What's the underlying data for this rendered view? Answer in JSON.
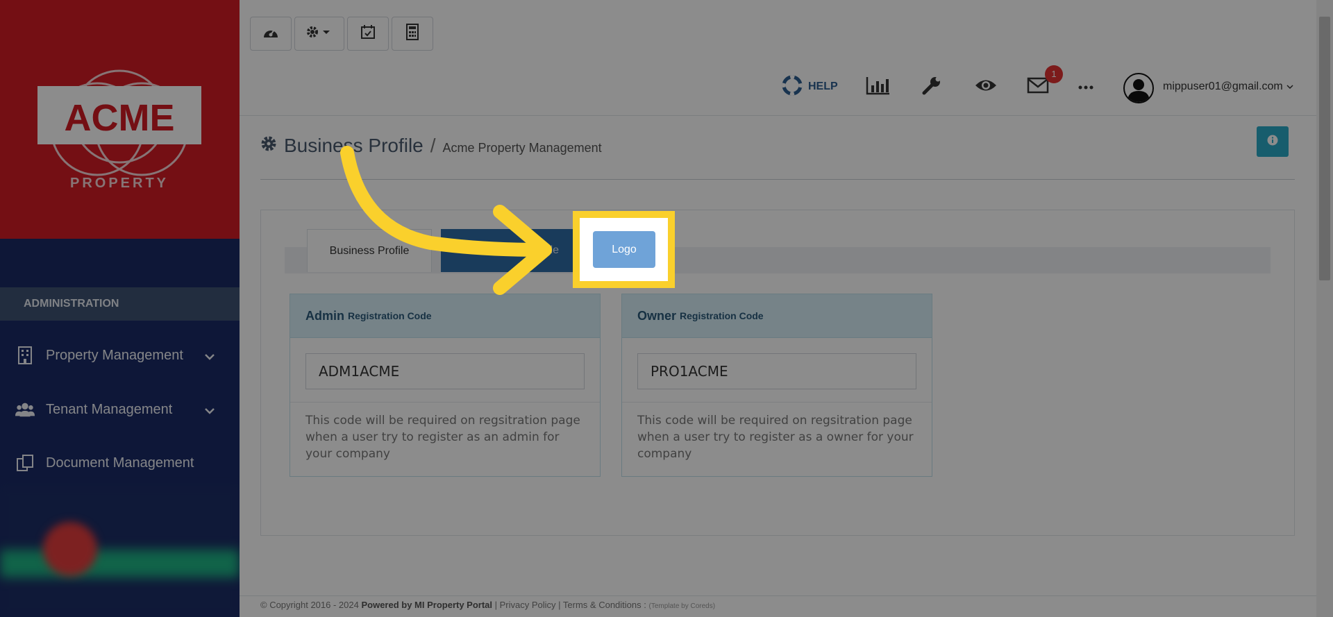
{
  "sidebar": {
    "logo": {
      "brand": "ACME",
      "sub": "PROPERTY"
    },
    "section_header": "ADMINISTRATION",
    "items": [
      {
        "label": "Property Management",
        "icon": "building-icon",
        "has_chevron": true
      },
      {
        "label": "Tenant Management",
        "icon": "users-icon",
        "has_chevron": true
      },
      {
        "label": "Document Management",
        "icon": "documents-icon",
        "has_chevron": false
      }
    ]
  },
  "toolbar": {
    "buttons": [
      {
        "icon": "dashboard-icon"
      },
      {
        "icon": "gear-dropdown-icon"
      },
      {
        "icon": "calendar-check-icon"
      },
      {
        "icon": "calculator-icon"
      }
    ]
  },
  "topnav": {
    "help_label": "HELP",
    "mail_badge": "1",
    "user_email": "mippuser01@gmail.com"
  },
  "page": {
    "title": "Business Profile",
    "separator": "/",
    "subtitle": "Acme Property Management"
  },
  "tabs": {
    "profile": "Business Profile",
    "code": "ode",
    "logo": "Logo"
  },
  "cards": {
    "admin": {
      "head_strong": "Admin",
      "head_small": "Registration Code",
      "code": "ADM1ACME",
      "note": "This code will be required on regsitration page when a user try to register as an admin for your company"
    },
    "owner": {
      "head_strong": "Owner",
      "head_small": "Registration Code",
      "code": "PRO1ACME",
      "note": "This code will be required on regsitration page when a user try to register as a owner for your company"
    }
  },
  "footer": {
    "copyright": "© Copyright 2016 - 2024",
    "powered": "Powered by MI Property Portal",
    "privacy": "Privacy Policy",
    "terms": "Terms & Conditions",
    "template": "(Template by Coreds)"
  },
  "colors": {
    "sidebar_bg": "#1b2b66",
    "logo_bg": "#d41c25",
    "highlight": "#fad02c",
    "accent": "#2f6ca7",
    "info": "#2aa9c6"
  }
}
